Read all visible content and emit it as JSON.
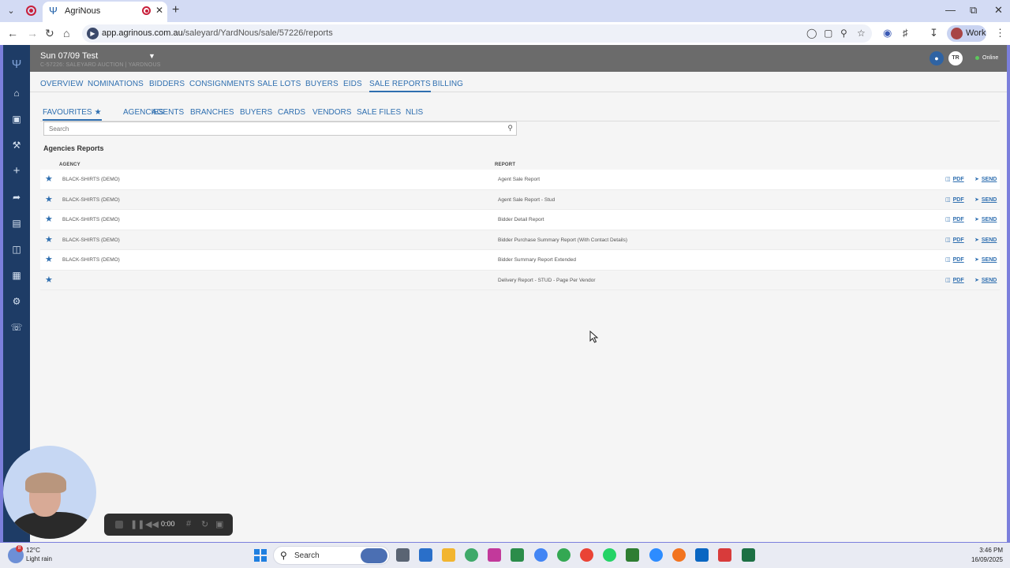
{
  "browser": {
    "tab_title": "AgriNous",
    "url_host": "app.agrinous.com.au",
    "url_path": "/saleyard/YardNous/sale/57226/reports",
    "profile_label": "Work"
  },
  "header": {
    "sale_title": "Sun 07/09 Test",
    "sale_subtitle": "C-57226: SALEYARD AUCTION | YARDNOUS",
    "avatar_initials": "TR",
    "status": "Online"
  },
  "main_nav": {
    "items": [
      {
        "label": "OVERVIEW"
      },
      {
        "label": "NOMINATIONS"
      },
      {
        "label": "BIDDERS"
      },
      {
        "label": "CONSIGNMENTS"
      },
      {
        "label": "SALE LOTS"
      },
      {
        "label": "BUYERS"
      },
      {
        "label": "EIDS"
      },
      {
        "label": "SALE REPORTS"
      },
      {
        "label": "BILLING"
      }
    ],
    "active": "SALE REPORTS"
  },
  "sub_nav": {
    "items": [
      {
        "label": "FAVOURITES"
      },
      {
        "label": "AGENCIES"
      },
      {
        "label": "AGENTS"
      },
      {
        "label": "BRANCHES"
      },
      {
        "label": "BUYERS"
      },
      {
        "label": "CARDS"
      },
      {
        "label": "VENDORS"
      },
      {
        "label": "SALE FILES"
      },
      {
        "label": "NLIS"
      }
    ],
    "active": "FAVOURITES"
  },
  "search": {
    "placeholder": "Search"
  },
  "section_title": "Agencies Reports",
  "table": {
    "columns": [
      "AGENCY",
      "REPORT"
    ],
    "pdf_label": "PDF",
    "send_label": "SEND",
    "rows": [
      {
        "agency": "BLACK-SHIRTS (DEMO)",
        "report": "Agent Sale Report"
      },
      {
        "agency": "BLACK-SHIRTS (DEMO)",
        "report": "Agent Sale Report - Stud"
      },
      {
        "agency": "BLACK-SHIRTS (DEMO)",
        "report": "Bidder Detail Report"
      },
      {
        "agency": "BLACK-SHIRTS (DEMO)",
        "report": "Bidder Purchase Summary Report (With Contact Details)"
      },
      {
        "agency": "BLACK-SHIRTS (DEMO)",
        "report": "Bidder Summary Report Extended"
      },
      {
        "agency": "",
        "report": "Delivery Report - STUD - Page Per Vendor"
      }
    ]
  },
  "recorder": {
    "time": "0:00"
  },
  "taskbar": {
    "weather_badge": "8",
    "temperature": "12°C",
    "weather": "Light rain",
    "search_label": "Search",
    "time": "3:46 PM",
    "date": "16/09/2025"
  },
  "colors": {
    "accent": "#2f6fb0",
    "sidebar": "#1e3c66",
    "header": "#6b6b6b"
  }
}
